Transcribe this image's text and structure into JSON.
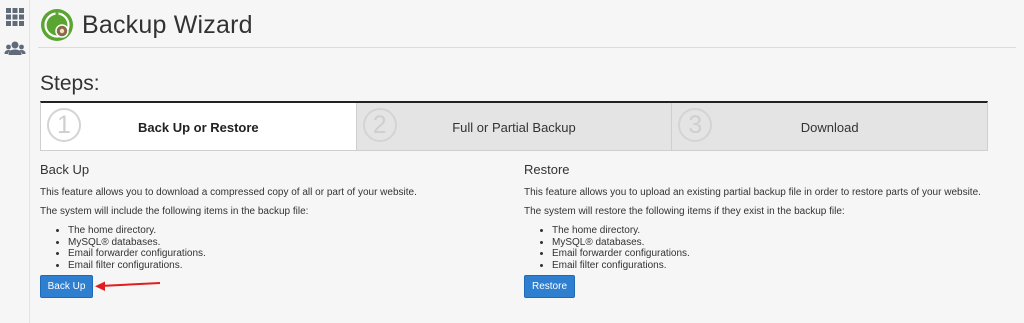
{
  "sidebar": {
    "icons": [
      "apps-grid-icon",
      "users-icon"
    ]
  },
  "header": {
    "title": "Backup Wizard",
    "icon": "backup-logo-icon"
  },
  "steps": {
    "title": "Steps:",
    "items": [
      {
        "number": "1",
        "label": "Back Up or Restore",
        "active": true
      },
      {
        "number": "2",
        "label": "Full or Partial Backup",
        "active": false
      },
      {
        "number": "3",
        "label": "Download",
        "active": false
      }
    ]
  },
  "backup": {
    "heading": "Back Up",
    "description": "This feature allows you to download a compressed copy of all or part of your website.",
    "intro": "The system will include the following items in the backup file:",
    "items": [
      "The home directory.",
      "MySQL® databases.",
      "Email forwarder configurations.",
      "Email filter configurations."
    ],
    "button_label": "Back Up"
  },
  "restore": {
    "heading": "Restore",
    "description": "This feature allows you to upload an existing partial backup file in order to restore parts of your website.",
    "intro": "The system will restore the following items if they exist in the backup file:",
    "items": [
      "The home directory.",
      "MySQL® databases.",
      "Email forwarder configurations.",
      "Email filter configurations."
    ],
    "button_label": "Restore"
  },
  "colors": {
    "accent": "#2e7fd0",
    "annotation_arrow": "#e11d1d",
    "logo_green": "#5aa532"
  }
}
